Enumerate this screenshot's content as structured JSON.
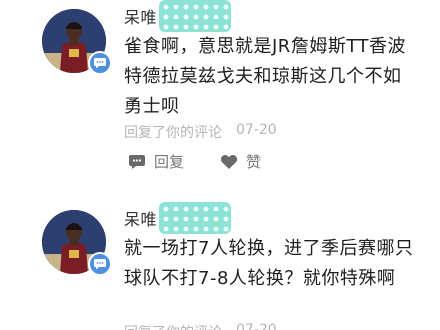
{
  "replies": [
    {
      "username": "呆唯",
      "content": "雀食啊，意思就是JR詹姆斯TT香波特德拉莫兹戈夫和琼斯这几个不如勇士呗",
      "meta_label": "回复了你的评论",
      "date": "07-20",
      "reply_label": "回复",
      "like_label": "赞"
    },
    {
      "username": "呆唯",
      "content": "就一场打7人轮换，进了季后赛哪只球队不打7-8人轮换？就你特殊啊",
      "meta_label": "回复了你的评论",
      "date": "07-20"
    }
  ],
  "colors": {
    "badge": "#4d8fe0",
    "name_mask": "#8de3d6",
    "meta_text": "#b5b5b5"
  },
  "icons": {
    "badge": "chat-bubble-icon",
    "reply": "comment-icon",
    "like": "heart-icon"
  }
}
